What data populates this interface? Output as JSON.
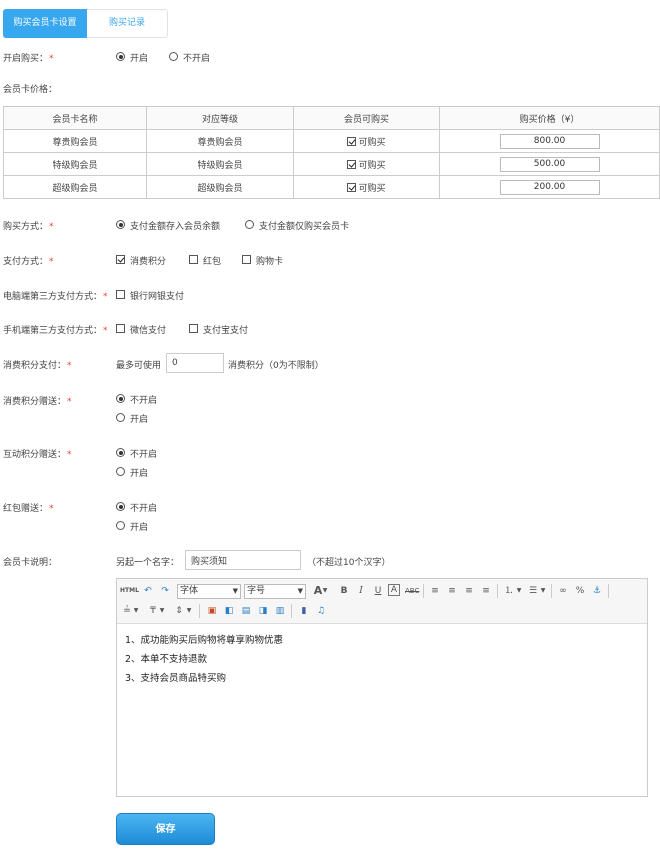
{
  "tabs": [
    {
      "label": "购买会员卡设置",
      "active": true
    },
    {
      "label": "购买记录",
      "active": false
    }
  ],
  "enable_purchase": {
    "label": "开启购买：",
    "required_mark": "*",
    "options": [
      "开启",
      "不开启"
    ],
    "selected": "开启"
  },
  "card_price": {
    "label": "会员卡价格：",
    "headers": [
      "会员卡名称",
      "对应等级",
      "会员可购买",
      "购买价格（¥）"
    ],
    "rows": [
      {
        "name": "尊贵购会员",
        "level": "尊贵购会员",
        "buy_label": "可购买",
        "buyable": true,
        "price": "800.00"
      },
      {
        "name": "特级购会员",
        "level": "特级购会员",
        "buy_label": "可购买",
        "buyable": true,
        "price": "500.00"
      },
      {
        "name": "超级购会员",
        "level": "超级购会员",
        "buy_label": "可购买",
        "buyable": true,
        "price": "200.00"
      }
    ]
  },
  "purchase_method": {
    "label": "购买方式：",
    "required_mark": "*",
    "options": [
      "支付金额存入会员余额",
      "支付金额仅购买会员卡"
    ],
    "selected": "支付金额存入会员余额"
  },
  "payment_method": {
    "label": "支付方式：",
    "required_mark": "*",
    "options": [
      {
        "label": "消费积分",
        "checked": true
      },
      {
        "label": "红包",
        "checked": false
      },
      {
        "label": "购物卡",
        "checked": false
      }
    ]
  },
  "pc_third_party": {
    "label": "电脑端第三方支付方式：",
    "required_mark": "*",
    "options": [
      {
        "label": "银行网银支付",
        "checked": false
      }
    ]
  },
  "mobile_third_party": {
    "label": "手机端第三方支付方式：",
    "required_mark": "*",
    "options": [
      {
        "label": "微信支付",
        "checked": false
      },
      {
        "label": "支付宝支付",
        "checked": false
      }
    ]
  },
  "points_payment": {
    "label": "消费积分支付：",
    "required_mark": "*",
    "prefix": "最多可使用",
    "value": "0",
    "suffix": "消费积分（0为不限制）"
  },
  "points_gift": {
    "label": "消费积分赠送：",
    "required_mark": "*",
    "options": [
      "不开启",
      "开启"
    ],
    "selected": "不开启"
  },
  "interact_points_gift": {
    "label": "互动积分赠送：",
    "required_mark": "*",
    "options": [
      "不开启",
      "开启"
    ],
    "selected": "不开启"
  },
  "red_packet_gift": {
    "label": "红包赠送：",
    "required_mark": "*",
    "options": [
      "不开启",
      "开启"
    ],
    "selected": "不开启"
  },
  "card_description": {
    "label": "会员卡说明：",
    "name_prefix": "另起一个名字：",
    "name_value": "购买须知",
    "name_hint": "（不超过10个汉字）",
    "toolbar": {
      "html_label": "HTML",
      "font_family": "字体",
      "font_size": "字号"
    },
    "content_lines": [
      "1、成功能购买后购物将尊享购物优惠",
      "2、本单不支持退款",
      "3、支持会员商品特买购"
    ]
  },
  "save_label": "保存",
  "colors": {
    "accent": "#37a7ef",
    "required": "#e43333",
    "save_button": "#1e8bd6"
  }
}
